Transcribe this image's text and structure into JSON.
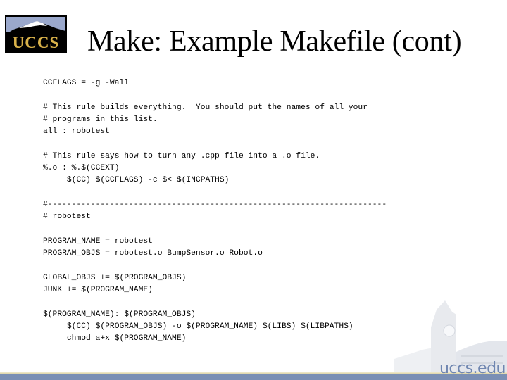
{
  "logo": {
    "text": "UCCS",
    "icon": "uccs-mountain-logo"
  },
  "slide": {
    "title": "Make: Example Makefile (cont)"
  },
  "code": {
    "lines": [
      "CCFLAGS = -g -Wall",
      "",
      "# This rule builds everything.  You should put the names of all your",
      "# programs in this list.",
      "all : robotest",
      "",
      "# This rule says how to turn any .cpp file into a .o file.",
      "%.o : %.$(CCEXT)",
      "     $(CC) $(CCFLAGS) -c $< $(INCPATHS)",
      "",
      "#-----------------------------------------------------------------------",
      "# robotest",
      "",
      "PROGRAM_NAME = robotest",
      "PROGRAM_OBJS = robotest.o BumpSensor.o Robot.o",
      "",
      "GLOBAL_OBJS += $(PROGRAM_OBJS)",
      "JUNK += $(PROGRAM_NAME)",
      "",
      "$(PROGRAM_NAME): $(PROGRAM_OBJS)",
      "     $(CC) $(PROGRAM_OBJS) -o $(PROGRAM_NAME) $(LIBS) $(LIBPATHS)",
      "     chmod a+x $(PROGRAM_NAME)"
    ]
  },
  "footer": {
    "url": "uccs.edu",
    "image": "campus-clock-tower"
  },
  "colors": {
    "gold": "#d9b24a",
    "blue_bar": "#7a8fb4",
    "url_blue": "#6f86b0"
  }
}
